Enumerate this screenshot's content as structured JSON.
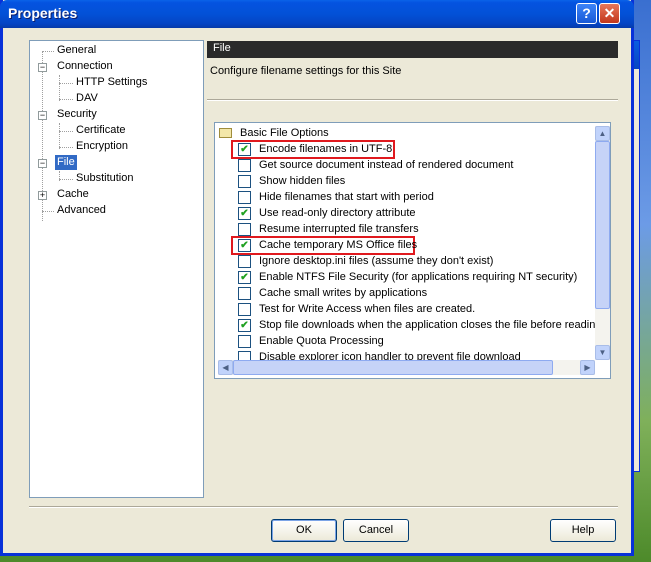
{
  "window": {
    "title": "Properties",
    "help_glyph": "?",
    "close_glyph": "✕"
  },
  "tree": {
    "items": [
      {
        "label": "General"
      },
      {
        "label": "Connection",
        "expander": "−"
      },
      {
        "label": "HTTP Settings"
      },
      {
        "label": "DAV"
      },
      {
        "label": "Security",
        "expander": "−"
      },
      {
        "label": "Certificate"
      },
      {
        "label": "Encryption"
      },
      {
        "label": "File",
        "expander": "−",
        "selected": true
      },
      {
        "label": "Substitution"
      },
      {
        "label": "Cache",
        "expander": "+"
      },
      {
        "label": "Advanced"
      }
    ]
  },
  "panel": {
    "header": "File",
    "description": "Configure filename settings for this Site",
    "group_label": "Basic File Options",
    "options": [
      {
        "label": "Encode filenames in UTF-8",
        "checked": true,
        "highlighted": true
      },
      {
        "label": "Get source document instead of rendered document",
        "checked": false
      },
      {
        "label": "Show hidden files",
        "checked": false
      },
      {
        "label": "Hide filenames that start with period",
        "checked": false
      },
      {
        "label": "Use read-only directory attribute",
        "checked": true
      },
      {
        "label": "Resume interrupted file transfers",
        "checked": false
      },
      {
        "label": "Cache temporary MS Office files",
        "checked": true,
        "highlighted": true
      },
      {
        "label": "Ignore desktop.ini files (assume they don't exist)",
        "checked": false
      },
      {
        "label": "Enable NTFS File Security (for applications requiring NT security)",
        "checked": true
      },
      {
        "label": "Cache small writes by applications",
        "checked": false
      },
      {
        "label": "Test for Write Access when files are created.",
        "checked": false
      },
      {
        "label": "Stop file downloads when the application closes the file before reading",
        "checked": true
      },
      {
        "label": "Enable Quota Processing",
        "checked": false
      },
      {
        "label": "Disable explorer icon handler to prevent file download",
        "checked": false
      }
    ],
    "check_glyph": "✔"
  },
  "buttons": {
    "ok": "OK",
    "cancel": "Cancel",
    "help": "Help"
  },
  "colors": {
    "highlight": "#e0191e",
    "selection": "#316ac5",
    "title_bar": "#0453e0"
  }
}
